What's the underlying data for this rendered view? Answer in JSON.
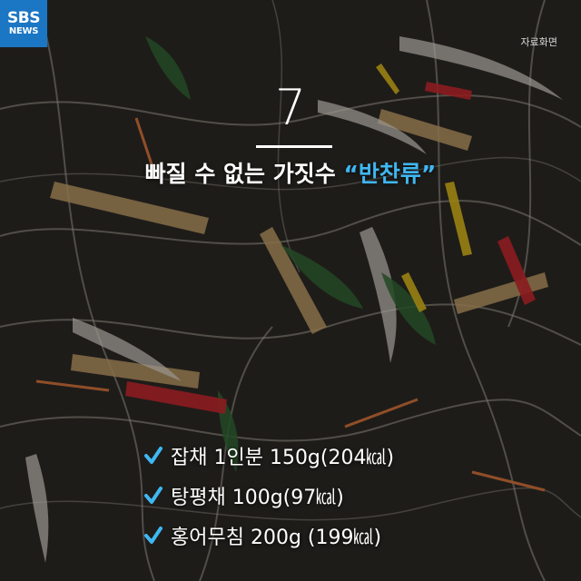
{
  "brand": {
    "line1": "SBS",
    "line2": "NEWS",
    "color": "#1b76c4"
  },
  "source_label": "자료화면",
  "number": "7",
  "headline": {
    "main": "빠질 수 없는 가짓수 ",
    "highlight": "“반찬류”",
    "highlight_color": "#3fb7f2"
  },
  "check_icon": "check-icon",
  "check_color": "#3fb7f2",
  "items": [
    "잡채 1인분 150g(204㎉)",
    "탕평채 100g(97㎉)",
    "홍어무침 200g (199㎉)"
  ]
}
